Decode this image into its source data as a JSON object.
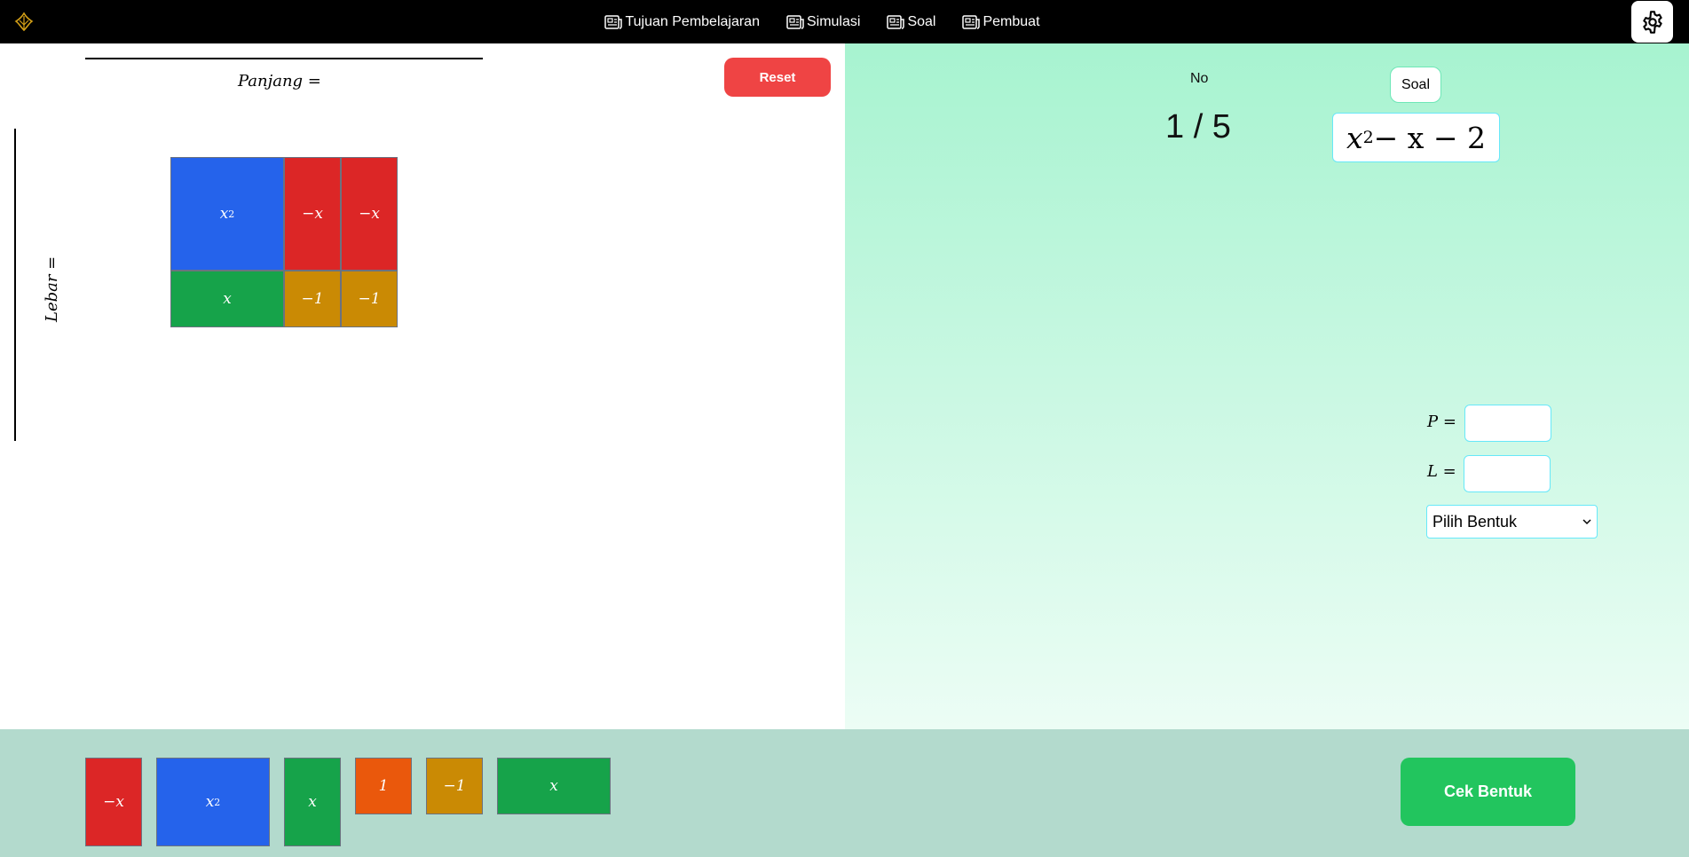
{
  "nav": {
    "items": [
      {
        "label": "Tujuan Pembelajaran"
      },
      {
        "label": "Simulasi"
      },
      {
        "label": "Soal"
      },
      {
        "label": "Pembuat"
      }
    ]
  },
  "board": {
    "panjang_label": "Panjang =",
    "lebar_label": "Lebar =",
    "reset_label": "Reset",
    "tiles": [
      {
        "label": "x",
        "sup": "2",
        "color": "#2563eb"
      },
      {
        "label": "−x",
        "sup": "",
        "color": "#dc2626"
      },
      {
        "label": "−x",
        "sup": "",
        "color": "#dc2626"
      },
      {
        "label": "x",
        "sup": "",
        "color": "#16a34a"
      },
      {
        "label": "−1",
        "sup": "",
        "color": "#ca8a04"
      },
      {
        "label": "−1",
        "sup": "",
        "color": "#ca8a04"
      }
    ]
  },
  "question": {
    "no_label": "No",
    "progress": "1 / 5",
    "soal_label": "Soal",
    "expression": {
      "base": "x",
      "exp": "2",
      "rest": " − x − 2"
    },
    "p_label": "P =",
    "l_label": "L =",
    "p_value": "",
    "l_value": "",
    "select_value": "Pilih Bentuk"
  },
  "tray": {
    "tiles": [
      {
        "label": "−x",
        "sup": "",
        "color": "#dc2626"
      },
      {
        "label": "x",
        "sup": "2",
        "color": "#2563eb"
      },
      {
        "label": "x",
        "sup": "",
        "color": "#16a34a"
      },
      {
        "label": "1",
        "sup": "",
        "color": "#ea580c"
      },
      {
        "label": "−1",
        "sup": "",
        "color": "#ca8a04"
      },
      {
        "label": "x",
        "sup": "",
        "color": "#16a34a"
      }
    ],
    "cek_label": "Cek Bentuk"
  }
}
